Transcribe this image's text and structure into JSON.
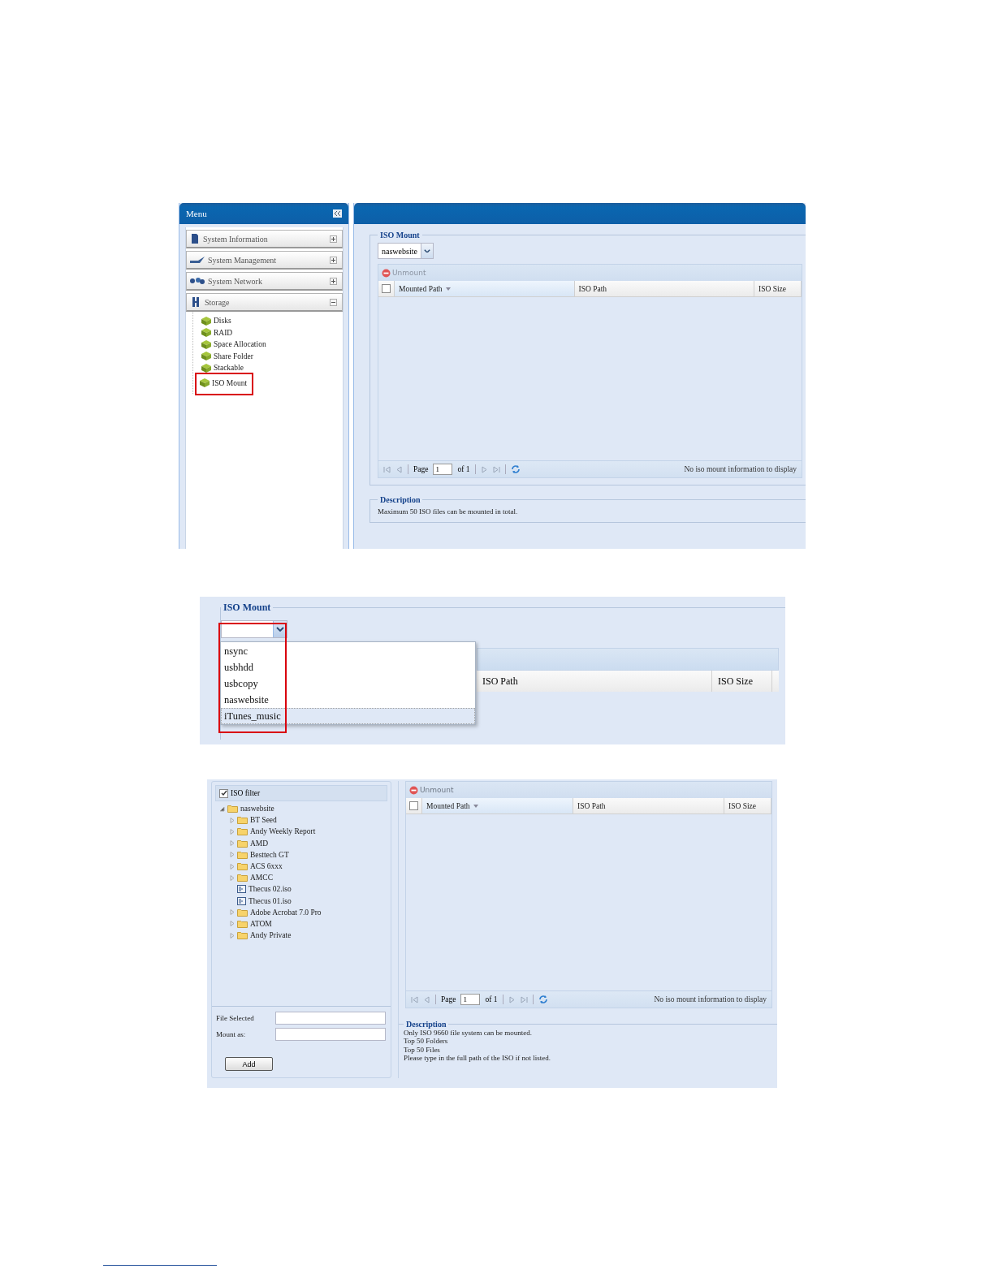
{
  "figure_1": {
    "menu": {
      "title": "Menu",
      "sections": [
        {
          "label": "System Information",
          "expanded": false
        },
        {
          "label": "System Management",
          "expanded": false
        },
        {
          "label": "System Network",
          "expanded": false
        },
        {
          "label": "Storage",
          "expanded": true,
          "items": [
            {
              "label": "Disks",
              "highlighted": false
            },
            {
              "label": "RAID",
              "highlighted": false
            },
            {
              "label": "Space Allocation",
              "highlighted": false
            },
            {
              "label": "Share Folder",
              "highlighted": false
            },
            {
              "label": "Stackable",
              "highlighted": false
            },
            {
              "label": "ISO Mount",
              "highlighted": true
            }
          ]
        }
      ]
    },
    "main": {
      "legend": "ISO Mount",
      "share_select": {
        "value": "naswebsite"
      },
      "grid": {
        "unmount": {
          "label": "Unmount",
          "disabled": true
        },
        "select_all_checked": false,
        "columns": [
          {
            "label": "Mounted Path",
            "sorted": true
          },
          {
            "label": "ISO Path",
            "sorted": false
          },
          {
            "label": "ISO Size",
            "sorted": false
          }
        ],
        "pager": {
          "page_label": "Page",
          "page": "1",
          "of_label": "of 1",
          "status": "No iso mount information to display"
        }
      },
      "description": {
        "legend": "Description",
        "lines": [
          "Maximum 50 ISO files can be mounted in total."
        ]
      }
    }
  },
  "figure_2": {
    "legend": "ISO Mount",
    "dropdown": {
      "open": true,
      "highlighted": true,
      "options": [
        {
          "label": "nsync",
          "selected": false
        },
        {
          "label": "usbhdd",
          "selected": false
        },
        {
          "label": "usbcopy",
          "selected": false
        },
        {
          "label": "naswebsite",
          "selected": false
        },
        {
          "label": "iTunes_music",
          "selected": true
        }
      ]
    },
    "columns": [
      {
        "label": "ISO Path"
      },
      {
        "label": "ISO Size"
      }
    ]
  },
  "figure_3": {
    "filter": {
      "label": "ISO filter",
      "checked": true
    },
    "tree": {
      "label": "naswebsite",
      "expanded": true,
      "children": [
        {
          "kind": "folder",
          "label": "BT Seed",
          "expanded": false
        },
        {
          "kind": "folder",
          "label": "Andy Weekly Report",
          "expanded": false
        },
        {
          "kind": "folder",
          "label": "AMD",
          "expanded": false
        },
        {
          "kind": "folder",
          "label": "Besttech GT",
          "expanded": false
        },
        {
          "kind": "folder",
          "label": "ACS 6xxx",
          "expanded": false
        },
        {
          "kind": "folder",
          "label": "AMCC",
          "expanded": false
        },
        {
          "kind": "file",
          "label": "Thecus 02.iso"
        },
        {
          "kind": "file",
          "label": "Thecus 01.iso"
        },
        {
          "kind": "folder",
          "label": "Adobe Acrobat 7.0 Pro",
          "expanded": false
        },
        {
          "kind": "folder",
          "label": "ATOM",
          "expanded": false
        },
        {
          "kind": "folder",
          "label": "Andy Private",
          "expanded": false
        }
      ]
    },
    "form": {
      "fields": [
        {
          "label": "File Selected"
        },
        {
          "label": "Mount as:"
        }
      ],
      "button": "Add"
    },
    "grid": {
      "unmount": {
        "label": "Unmount",
        "disabled": false
      },
      "select_all_checked": false,
      "columns": [
        {
          "label": "Mounted Path",
          "sorted": true
        },
        {
          "label": "ISO Path",
          "sorted": false
        },
        {
          "label": "ISO Size",
          "sorted": false
        }
      ],
      "pager": {
        "page_label": "Page",
        "page": "1",
        "of_label": "of 1",
        "status": "No iso mount information to display"
      }
    },
    "description": {
      "legend": "Description",
      "lines": [
        "Only ISO 9660 file system can be mounted.",
        "Top 50 Folders",
        "Top 50 Files",
        "Please type in the full path of the ISO if not listed."
      ]
    }
  }
}
